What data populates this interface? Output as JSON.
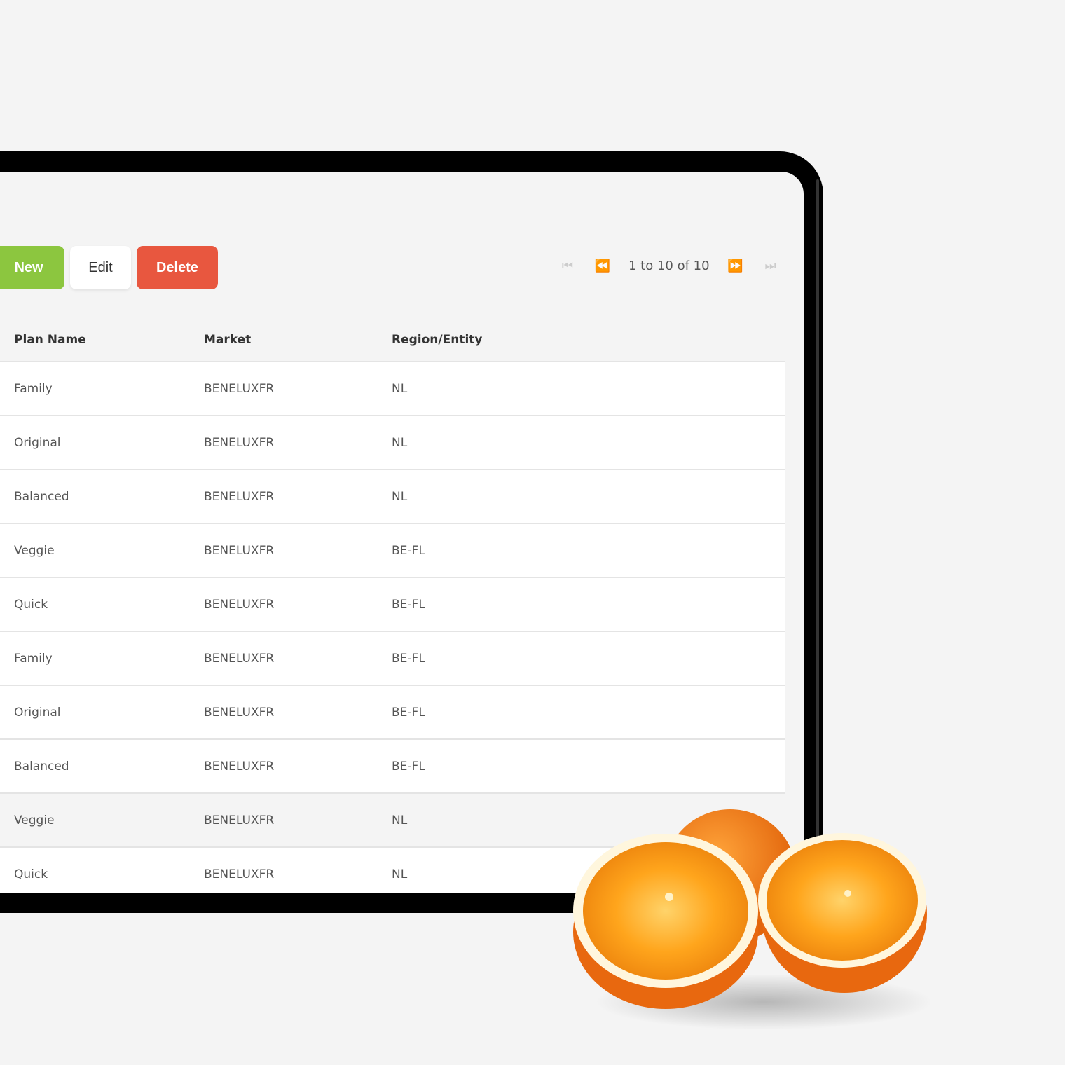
{
  "toolbar": {
    "new_label": "New",
    "edit_label": "Edit",
    "delete_label": "Delete"
  },
  "pager": {
    "text": "1 to 10 of 10",
    "icons": [
      "first-page-icon",
      "previous-page-icon",
      "next-page-icon",
      "last-page-icon"
    ]
  },
  "table": {
    "columns": [
      "Plan Name",
      "Market",
      "Region/Entity"
    ],
    "rows": [
      [
        "Family",
        "BENELUXFR",
        "NL"
      ],
      [
        "Original",
        "BENELUXFR",
        "NL"
      ],
      [
        "Balanced",
        "BENELUXFR",
        "NL"
      ],
      [
        "Veggie",
        "BENELUXFR",
        "BE-FL"
      ],
      [
        "Quick",
        "BENELUXFR",
        "BE-FL"
      ],
      [
        "Family",
        "BENELUXFR",
        "BE-FL"
      ],
      [
        "Original",
        "BENELUXFR",
        "BE-FL"
      ],
      [
        "Balanced",
        "BENELUXFR",
        "BE-FL"
      ],
      [
        "Veggie",
        "BENELUXFR",
        "NL"
      ],
      [
        "Quick",
        "BENELUXFR",
        "NL"
      ]
    ]
  },
  "colors": {
    "new": "#8cc63f",
    "delete": "#e8573f",
    "background": "#f4f4f4"
  }
}
